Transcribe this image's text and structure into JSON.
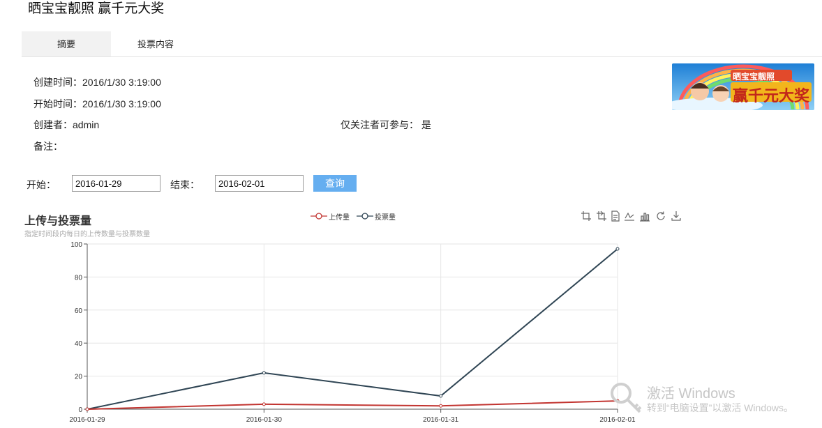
{
  "page_title": "晒宝宝靓照 赢千元大奖",
  "tabs": [
    {
      "label": "摘要",
      "active": true
    },
    {
      "label": "投票内容",
      "active": false
    }
  ],
  "info": {
    "created": "创建时间：2016/1/30 3:19:00",
    "started": "开始时间：2016/1/30 3:19:00",
    "creator": "创建者：admin",
    "followers_only": "仅关注者可参与：  是",
    "note": "备注："
  },
  "banner": {
    "top_text": "晒宝宝靓照",
    "main_text": "赢千元大奖"
  },
  "filter": {
    "start_label": "开始：",
    "start_value": "2016-01-29",
    "end_label": "结束：",
    "end_value": "2016-02-01",
    "query_label": "查询"
  },
  "chart_data": {
    "type": "line",
    "title": "上传与投票量",
    "subtitle": "指定时间段内每日的上传数量与投票数量",
    "categories": [
      "2016-01-29",
      "2016-01-30",
      "2016-01-31",
      "2016-02-01"
    ],
    "series": [
      {
        "name": "上传量",
        "values": [
          0,
          3,
          2,
          5
        ],
        "color": "#c23531"
      },
      {
        "name": "投票量",
        "values": [
          0,
          22,
          8,
          97
        ],
        "color": "#2f4554"
      }
    ],
    "ylim": [
      0,
      100
    ],
    "y_ticks": [
      0,
      20,
      40,
      60,
      80,
      100
    ],
    "grid": true,
    "legend_position": "top-center"
  },
  "toolbox": [
    "zoom-icon",
    "zoom-reset-icon",
    "data-view-icon",
    "line-chart-icon",
    "bar-chart-icon",
    "restore-icon",
    "save-image-icon"
  ],
  "watermark": {
    "title": "激活 Windows",
    "subtitle": "转到“电脑设置”以激活 Windows。"
  }
}
